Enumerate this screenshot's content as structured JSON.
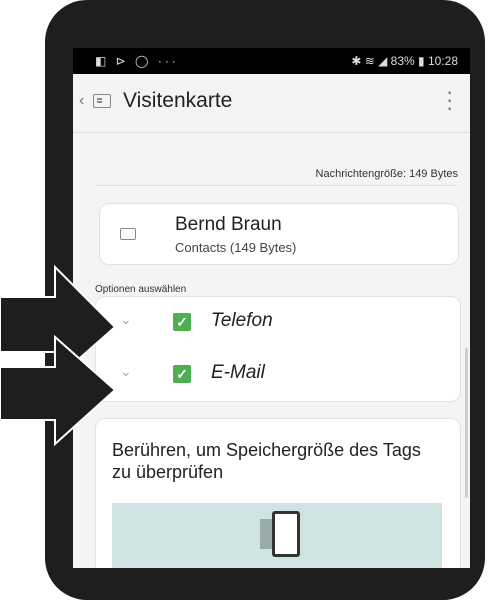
{
  "status": {
    "left_icons": "◧ ⊳ ◯ ···",
    "right_text": "✱ ≋ ◢ 83% ▮ 10:28"
  },
  "appbar": {
    "back_icon": "chevron-left-icon",
    "title": "Visitenkarte",
    "menu_icon": "more-vertical-icon"
  },
  "message": {
    "size_text": "Nachrichtengröße: 149 Bytes"
  },
  "contact": {
    "name": "Bernd Braun",
    "subtitle": "Contacts (149 Bytes)"
  },
  "options": {
    "label": "Optionen auswählen",
    "items": [
      {
        "label": "Telefon",
        "checked": true
      },
      {
        "label": "E-Mail",
        "checked": true
      }
    ]
  },
  "tag_card": {
    "text": "Berühren, um Speichergröße des Tags zu überprüfen"
  },
  "colors": {
    "accent_check": "#4caf50",
    "illustration_bg": "#cfe3e2"
  }
}
